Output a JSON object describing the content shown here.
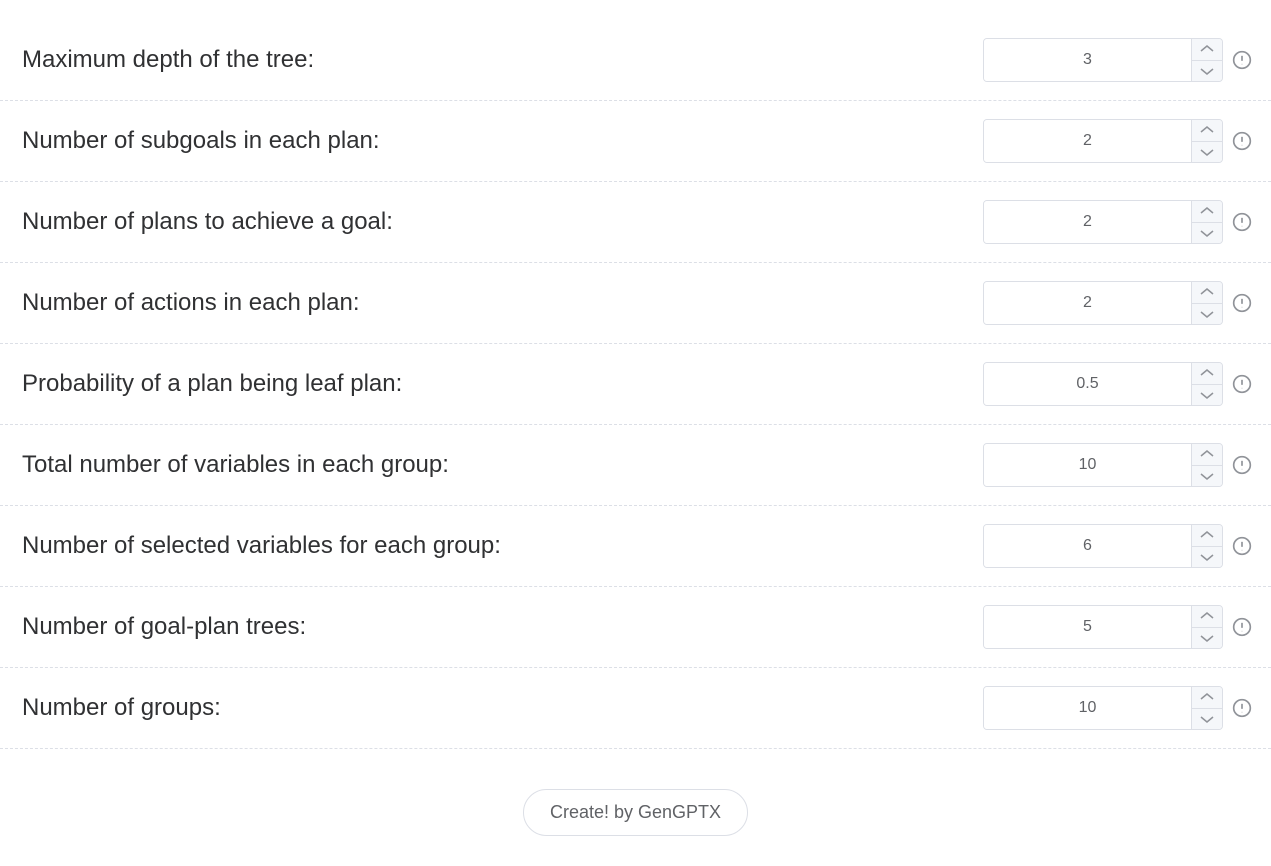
{
  "fields": [
    {
      "id": "max-depth",
      "label": "Maximum depth of the tree:",
      "value": "3"
    },
    {
      "id": "num-subgoals",
      "label": "Number of subgoals in each plan:",
      "value": "2"
    },
    {
      "id": "num-plans",
      "label": "Number of plans to achieve a goal:",
      "value": "2"
    },
    {
      "id": "num-actions",
      "label": "Number of actions in each plan:",
      "value": "2"
    },
    {
      "id": "prob-leaf",
      "label": "Probability of a plan being leaf plan:",
      "value": "0.5"
    },
    {
      "id": "total-vars",
      "label": "Total number of variables in each group:",
      "value": "10"
    },
    {
      "id": "selected-vars",
      "label": "Number of selected variables for each group:",
      "value": "6"
    },
    {
      "id": "num-trees",
      "label": "Number of goal-plan trees:",
      "value": "5"
    },
    {
      "id": "num-groups",
      "label": "Number of groups:",
      "value": "10"
    }
  ],
  "buttons": {
    "create": "Create! by GenGPTX"
  }
}
